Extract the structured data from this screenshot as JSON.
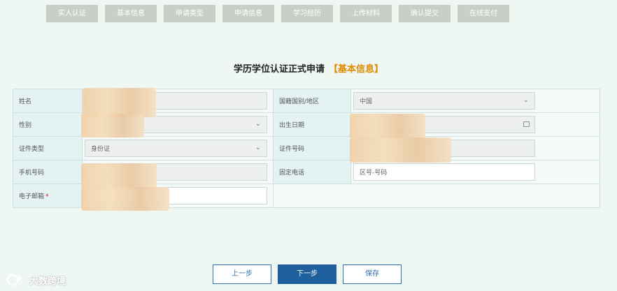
{
  "steps": [
    "实人认证",
    "基本信息",
    "申请类型",
    "申请信息",
    "学习经历",
    "上传材料",
    "确认提交",
    "在线支付"
  ],
  "page_title": "学历学位认证正式申请",
  "page_subtitle": "【基本信息】",
  "fields": {
    "name_label": "姓名",
    "nationality_label": "国籍国别/地区",
    "nationality_value": "中国",
    "gender_label": "性别",
    "birth_date_label": "出生日期",
    "id_type_label": "证件类型",
    "id_type_value": "身份证",
    "id_number_label": "证件号码",
    "phone_label": "手机号码",
    "landline_label": "固定电话",
    "landline_placeholder": "区号-号码",
    "email_label": "电子邮箱",
    "email_required_mark": "*"
  },
  "buttons": {
    "prev": "上一步",
    "next": "下一步",
    "save": "保存"
  },
  "watermark": "大数跨境",
  "colors": {
    "accent_orange": "#e08a00",
    "primary_blue": "#1f5f9e",
    "required_red": "#e01515"
  }
}
